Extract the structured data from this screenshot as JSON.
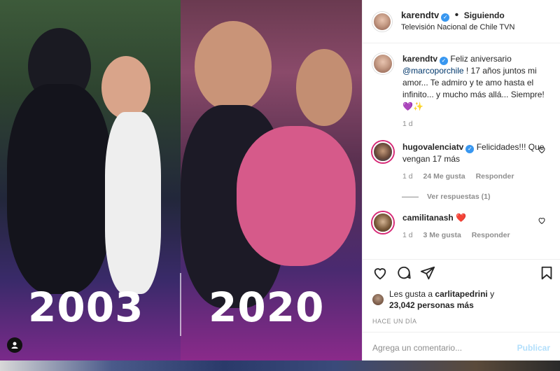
{
  "photo": {
    "year_left": "2003",
    "year_right": "2020"
  },
  "header": {
    "username": "karendtv",
    "separator": "•",
    "follow_status": "Siguiendo",
    "location": "Televisión Nacional de Chile TVN"
  },
  "caption": {
    "username": "karendtv",
    "text_before": "Feliz aniversario",
    "mention": "@marcoporchile",
    "text_after": "! 17 años juntos mi amor... Te admiro y te amo hasta el infinito... y mucho más allá... Siempre!",
    "emoji": "💜✨",
    "time": "1 d"
  },
  "comments": [
    {
      "username": "hugovalenciatv",
      "text": "Felicidades!!! Que vengan 17 más",
      "time": "1 d",
      "likes": "24 Me gusta",
      "reply": "Responder",
      "view_replies": "Ver respuestas (1)"
    },
    {
      "username": "camilitanash",
      "text": "❤️",
      "time": "1 d",
      "likes": "3 Me gusta",
      "reply": "Responder"
    }
  ],
  "likes": {
    "prefix": "Les gusta a",
    "user": "carlitapedrini",
    "suffix": "y",
    "count": "23,042 personas más"
  },
  "posted": "HACE UN DÍA",
  "add_comment": {
    "placeholder": "Agrega un comentario...",
    "publish": "Publicar"
  },
  "colors": {
    "accent": "#3897f0",
    "mention": "#00376b",
    "muted": "#8e8e8e",
    "publish_disabled": "#b2dffc"
  }
}
